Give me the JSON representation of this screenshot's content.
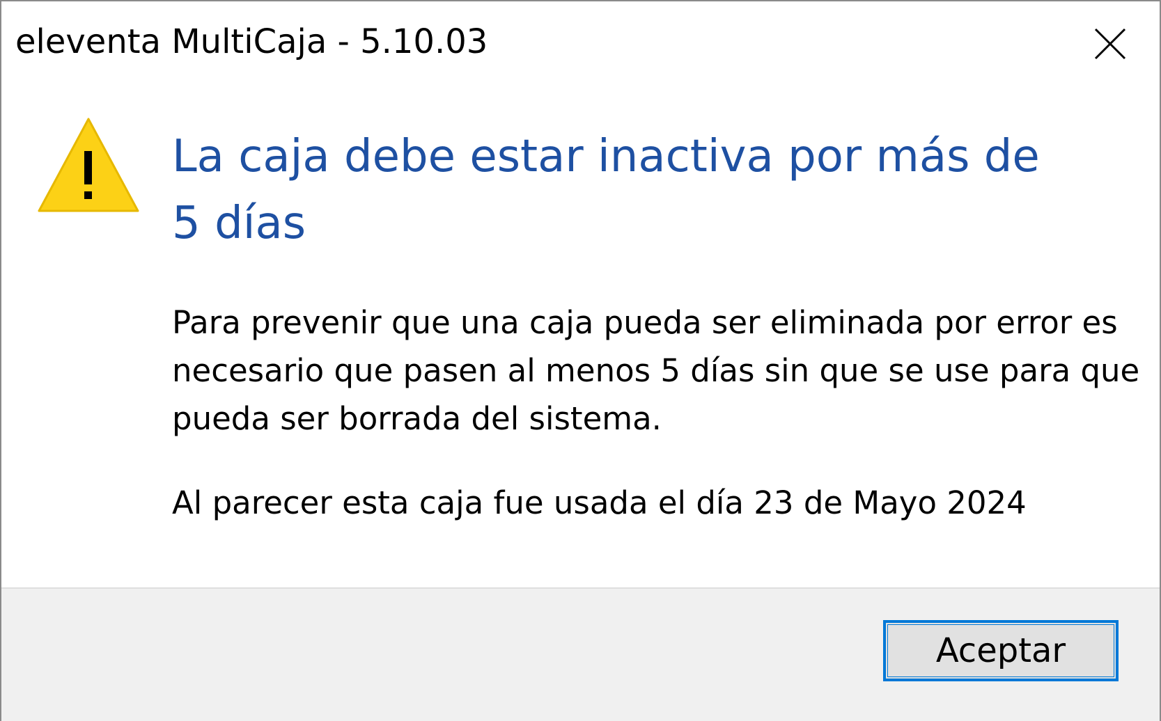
{
  "window": {
    "title": "eleventa MultiCaja - 5.10.03"
  },
  "icons": {
    "warning": "warning-icon",
    "close": "close-icon"
  },
  "message": {
    "heading": "La caja debe estar inactiva por más de 5 días",
    "body": "Para prevenir que una caja pueda ser eliminada por error es necesario que pasen al menos 5 días sin que se use para que pueda ser borrada del sistema.",
    "detail": "Al parecer esta caja fue usada el día 23 de Mayo 2024"
  },
  "footer": {
    "accept_label": "Aceptar"
  },
  "colors": {
    "heading": "#1e50a2",
    "accent": "#0078d7",
    "warning_fill": "#fcd116",
    "footer_bg": "#f0f0f0"
  }
}
